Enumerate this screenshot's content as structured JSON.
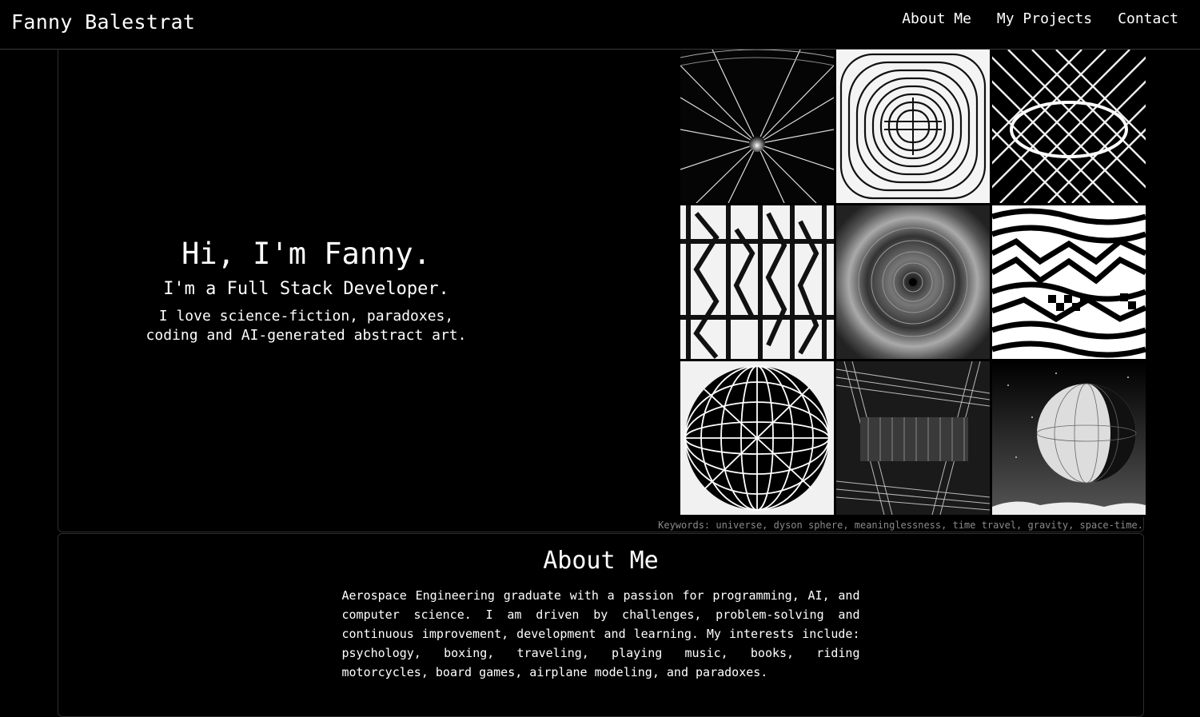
{
  "header": {
    "brand": "Fanny Balestrat",
    "nav": [
      "About Me",
      "My Projects",
      "Contact"
    ]
  },
  "hero": {
    "greeting": "Hi, I'm Fanny.",
    "role": "I'm a Full Stack Developer.",
    "tagline_line1": "I love science-fiction, paradoxes,",
    "tagline_line2": "coding and AI-generated abstract art.",
    "gallery": [
      "abstract-light-rays-art",
      "abstract-concentric-lines-art",
      "abstract-net-ellipse-art",
      "abstract-geometric-bars-art",
      "abstract-vortex-circles-art",
      "abstract-zebra-waves-art",
      "abstract-wire-sphere-art",
      "abstract-line-warp-art",
      "abstract-planet-sphere-art"
    ],
    "keywords": "Keywords: universe, dyson sphere, meaninglessness, time travel, gravity, space-time."
  },
  "about": {
    "title": "About Me",
    "text": "Aerospace Engineering graduate with a passion for programming, AI, and computer science. I am driven by challenges, problem-solving and continuous improvement, development and learning. My interests include: psychology, boxing, traveling, playing music, books, riding motorcycles, board games, airplane modeling, and paradoxes."
  },
  "colors": {
    "background": "#000000",
    "text": "#ffffff",
    "border": "#2e2e2e",
    "muted": "#8a8a8a"
  }
}
